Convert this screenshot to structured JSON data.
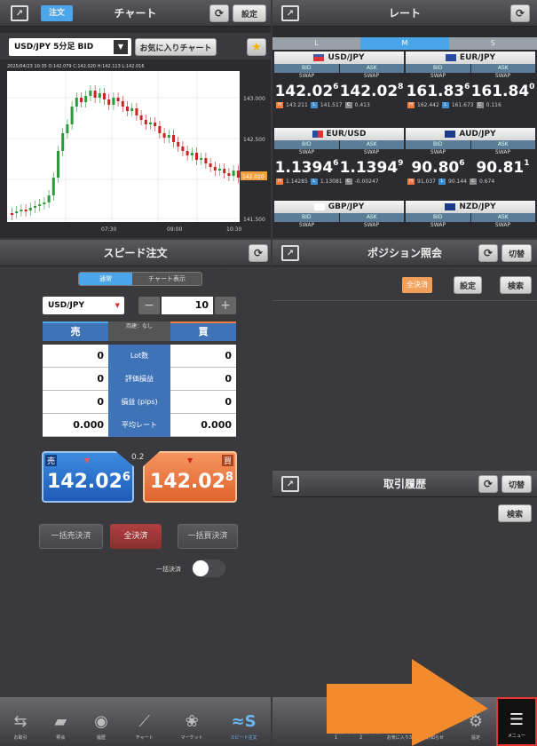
{
  "chart_panel": {
    "tab_active": "注文",
    "title": "チャート",
    "settings_label": "設定",
    "symbol_select": "USD/JPY 5分足 BID",
    "favorite_button": "お気に入りチャート",
    "ohlc_line": "2025/04/23 10:35 O:142.079 C:142.020 H:142.113 L:142.016",
    "y_ticks": [
      "143.000",
      "142.500",
      "142.020",
      "141.500"
    ],
    "x_ticks": [
      "07:30",
      "09:00",
      "10:30"
    ]
  },
  "rate_panel": {
    "title": "レート",
    "size_tabs": [
      "L",
      "M",
      "S"
    ],
    "active_tab": "M",
    "bid_label": "BID",
    "ask_label": "ASK",
    "swap_label": "SWAP",
    "pairs": [
      {
        "name": "USD/JPY",
        "bid_main": "142.02",
        "bid_sup": "6",
        "ask_main": "142.02",
        "ask_sup": "8",
        "h": "143.211",
        "l": "141.517",
        "c": "0.413"
      },
      {
        "name": "EUR/JPY",
        "bid_main": "161.83",
        "bid_sup": "6",
        "ask_main": "161.84",
        "ask_sup": "0",
        "h": "162.442",
        "l": "161.673",
        "c": "0.116"
      },
      {
        "name": "EUR/USD",
        "bid_main": "1.1394",
        "bid_sup": "6",
        "ask_main": "1.1394",
        "ask_sup": "9",
        "h": "1.14285",
        "l": "1.13081",
        "c": "-0.00247"
      },
      {
        "name": "AUD/JPY",
        "bid_main": "90.80",
        "bid_sup": "6",
        "ask_main": "90.81",
        "ask_sup": "1",
        "h": "91.037",
        "l": "90.144",
        "c": "0.674"
      },
      {
        "name": "GBP/JPY"
      },
      {
        "name": "NZD/JPY"
      }
    ],
    "hl_tags": {
      "h": "H",
      "l": "L",
      "c": "C"
    }
  },
  "speed_order": {
    "title": "スピード注文",
    "mode_tabs": [
      "通常",
      "チャート表示"
    ],
    "symbol": "USD/JPY",
    "quantity": "10",
    "sell_label": "売",
    "buy_label": "買",
    "both_label": "両建：なし",
    "rows": [
      {
        "label": "Lot数",
        "sell": "0",
        "buy": "0"
      },
      {
        "label": "評価損益",
        "sell": "0",
        "buy": "0"
      },
      {
        "label": "損益 (pips)",
        "sell": "0",
        "buy": "0"
      },
      {
        "label": "平均レート",
        "sell": "0.000",
        "buy": "0.000"
      }
    ],
    "spread": "0.2",
    "sell_price_main": "142.02",
    "sell_price_sup": "6",
    "buy_price_main": "142.02",
    "buy_price_sup": "8",
    "sell_tag": "売",
    "buy_tag": "買",
    "bulk_sell": "一括売決済",
    "close_all": "全決済",
    "bulk_buy": "一括買決済",
    "bulk_toggle_label": "一括決済"
  },
  "position_panel": {
    "title": "ポジション照会",
    "switch_label": "切替",
    "close_all": "全決済",
    "settings": "設定",
    "search": "検索"
  },
  "history_panel": {
    "title": "取引履歴",
    "switch_label": "切替",
    "search": "検索"
  },
  "tabbar_left": [
    "お取引",
    "照会",
    "履歴",
    "チャート",
    "マーケット",
    "スピード注文"
  ],
  "tabbar_right": [
    "お気に入り1",
    "お気に入り2",
    "お気に入り3",
    "お知らせ",
    "設定",
    "メニュー"
  ],
  "colors": {
    "accent_blue": "#3f73b8",
    "sell_blue": "#2d6fd1",
    "buy_orange": "#f07b3f",
    "arrow_orange": "#f28a2e"
  }
}
